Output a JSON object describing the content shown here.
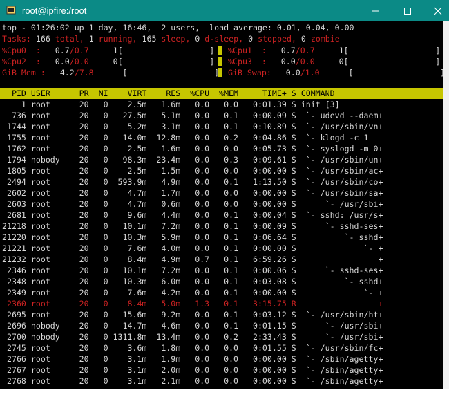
{
  "window": {
    "title": "root@ipfire:/root"
  },
  "summary": {
    "line1": "top - 01:26:02 up 1 day, 16:46,  2 users,  load average: 0.01, 0.04, 0.00",
    "tasks": {
      "label": "Tasks:",
      "total": "166",
      "total_label": "total,",
      "running": "1",
      "running_label": "running,",
      "sleeping": "165",
      "sleeping_label": "sleep,",
      "dsleep": "0",
      "dsleep_label": "d-sleep,",
      "stopped": "0",
      "stopped_label": "stopped,",
      "zombie": "0",
      "zombie_label": "zombie"
    },
    "cpu0": {
      "label": "%Cpu0  :",
      "v1": "0.7",
      "v2": "0.7",
      "bar": "1[                  ]"
    },
    "cpu1": {
      "label": "%Cpu1  :",
      "v1": "0.7",
      "v2": "0.7",
      "bar": "1[                  ]"
    },
    "cpu2": {
      "label": "%Cpu2  :",
      "v1": "0.0",
      "v2": "0.0",
      "bar": "0[                  ]"
    },
    "cpu3": {
      "label": "%Cpu3  :",
      "v1": "0.0",
      "v2": "0.0",
      "bar": "0[                  ]"
    },
    "mem": {
      "label": "GiB Mem :",
      "v1": "4.2",
      "v2": "7.8",
      "bar": "[                  ]"
    },
    "swap": {
      "label": "GiB Swap:",
      "v1": "0.0",
      "v2": "1.0",
      "bar": "[                  ]"
    }
  },
  "table": {
    "header": "  PID USER      PR  NI    VIRT    RES  %CPU  %MEM     TIME+ S COMMAND",
    "rows": [
      "    1 root      20   0    2.5m   1.6m   0.0   0.0   0:01.39 S init [3]",
      "  736 root      20   0   27.5m   5.1m   0.0   0.1   0:00.09 S  `- udevd --daem+",
      " 1744 root      20   0    5.2m   3.1m   0.0   0.1   0:10.89 S  `- /usr/sbin/vn+",
      " 1755 root      20   0   14.0m  12.8m   0.0   0.2   0:04.86 S  `- klogd -c 1",
      " 1762 root      20   0    2.5m   1.6m   0.0   0.0   0:05.73 S  `- syslogd -m 0+",
      " 1794 nobody    20   0   98.3m  23.4m   0.0   0.3   0:09.61 S  `- /usr/sbin/un+",
      " 1805 root      20   0    2.5m   1.5m   0.0   0.0   0:00.00 S  `- /usr/sbin/ac+",
      " 2494 root      20   0  593.9m   4.9m   0.0   0.1   1:13.50 S  `- /usr/sbin/co+",
      " 2602 root      20   0    4.7m   1.7m   0.0   0.0   0:00.00 S  `- /usr/sbin/sa+",
      " 2603 root      20   0    4.7m   0.6m   0.0   0.0   0:00.00 S      `- /usr/sbi+",
      " 2681 root      20   0    9.6m   4.4m   0.0   0.1   0:00.04 S  `- sshd: /usr/s+",
      "21218 root      20   0   10.1m   7.2m   0.0   0.1   0:00.09 S      `- sshd-ses+",
      "21220 root      20   0   10.3m   5.9m   0.0   0.1   0:06.64 S          `- sshd+",
      "21221 root      20   0    7.6m   4.0m   0.0   0.1   0:00.00 S              `- +",
      "21232 root      20   0    8.4m   4.9m   0.7   0.1   6:59.26 S                 +",
      " 2346 root      20   0   10.1m   7.2m   0.0   0.1   0:00.06 S      `- sshd-ses+",
      " 2348 root      20   0   10.3m   6.0m   0.0   0.1   0:03.08 S          `- sshd+",
      " 2349 root      20   0    7.6m   4.2m   0.0   0.1   0:00.00 S              `- +",
      " 2360 root      20   0    8.4m   5.0m   1.3   0.1   3:15.75 R                 +",
      " 2695 root      20   0   15.6m   9.2m   0.0   0.1   0:03.12 S  `- /usr/sbin/ht+",
      " 2696 nobody    20   0   14.7m   4.6m   0.0   0.1   0:01.15 S      `- /usr/sbi+",
      " 2700 nobody    20   0 1311.8m  13.4m   0.0   0.2   2:33.43 S      `- /usr/sbi+",
      " 2745 root      20   0    3.6m   1.8m   0.0   0.0   0:01.55 S  `- /usr/sbin/fc+",
      " 2766 root      20   0    3.1m   1.9m   0.0   0.0   0:00.00 S  `- /sbin/agetty+",
      " 2767 root      20   0    3.1m   2.0m   0.0   0.0   0:00.00 S  `- /sbin/agetty+",
      " 2768 root      20   0    3.1m   2.1m   0.0   0.0   0:00.00 S  `- /sbin/agetty+"
    ],
    "highlight_index": 18
  },
  "colors": {
    "titlebar": "#0b8a86",
    "header_bar": "#c6c600",
    "terminal_bg": "#000000",
    "alert_red": "#cc2222"
  }
}
